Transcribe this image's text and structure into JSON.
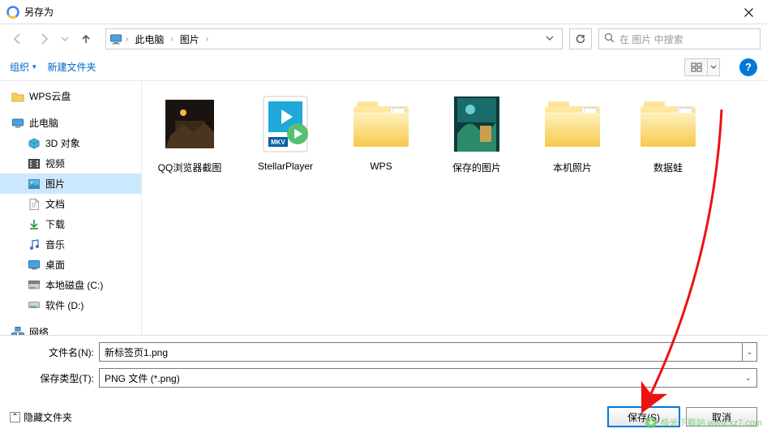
{
  "title": "另存为",
  "breadcrumb": {
    "root": "此电脑",
    "folder": "图片"
  },
  "search_placeholder": "在 图片 中搜索",
  "toolbar": {
    "organize": "组织",
    "newfolder": "新建文件夹"
  },
  "sidebar": {
    "wps": "WPS云盘",
    "pc": "此电脑",
    "items": [
      {
        "label": "3D 对象"
      },
      {
        "label": "视频"
      },
      {
        "label": "图片"
      },
      {
        "label": "文档"
      },
      {
        "label": "下载"
      },
      {
        "label": "音乐"
      },
      {
        "label": "桌面"
      },
      {
        "label": "本地磁盘 (C:)"
      },
      {
        "label": "软件 (D:)"
      }
    ],
    "network": "网络"
  },
  "grid": [
    {
      "name": "QQ浏览器截图",
      "type": "thumb-dark"
    },
    {
      "name": "StellarPlayer",
      "type": "mkv"
    },
    {
      "name": "WPS",
      "type": "folder"
    },
    {
      "name": "保存的图片",
      "type": "thumb-art"
    },
    {
      "name": "本机照片",
      "type": "folder"
    },
    {
      "name": "数据蛙",
      "type": "folder"
    }
  ],
  "form": {
    "filename_label": "文件名(N):",
    "filename_value": "新标签页1.png",
    "type_label": "保存类型(T):",
    "type_value": "PNG 文件 (*.png)"
  },
  "footer": {
    "hide": "隐藏文件夹",
    "save": "保存(S)",
    "cancel": "取消"
  },
  "watermark": "极光下载站 www.xz7.com"
}
